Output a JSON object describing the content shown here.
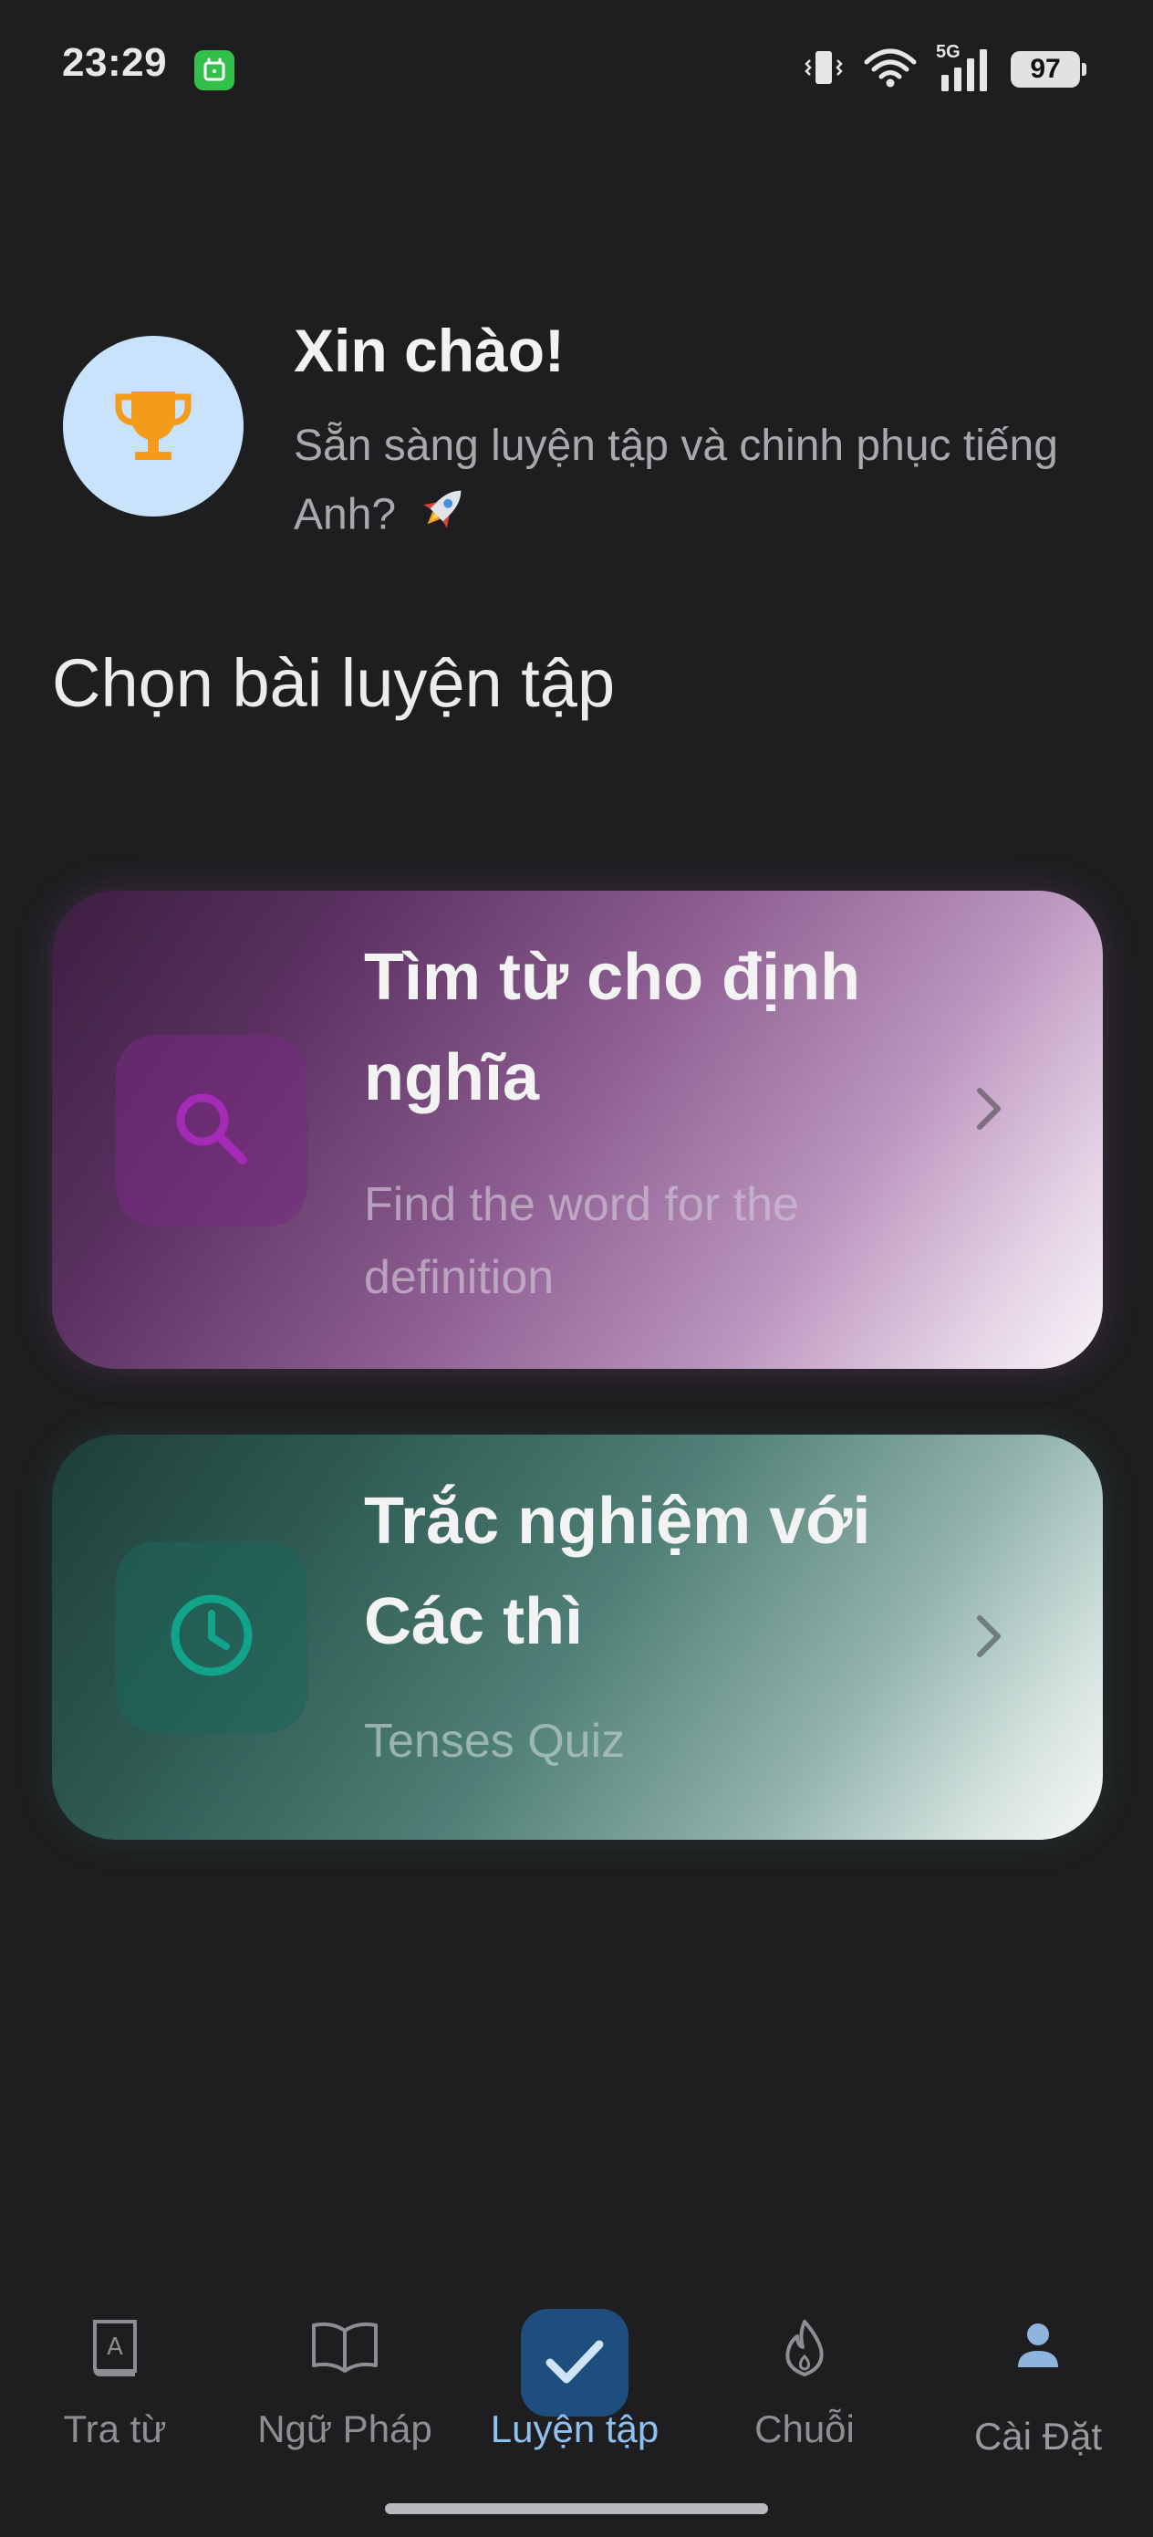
{
  "status_bar": {
    "time": "23:29",
    "battery": "97",
    "network": "5G",
    "icons": [
      "app-notification-icon",
      "vibrate-icon",
      "wifi-icon",
      "signal-icon",
      "battery-icon"
    ]
  },
  "greeting": {
    "title": "Xin chào!",
    "subtitle": "Sẵn sàng luyện tập và chinh phục tiếng Anh?",
    "avatar_icon": "trophy-icon",
    "emoji_icon": "rocket-icon"
  },
  "section": {
    "title": "Chọn bài luyện tập"
  },
  "cards": [
    {
      "title": "Tìm từ cho định nghĩa",
      "subtitle": "Find the word for the definition",
      "icon": "search-icon",
      "accent": "#9c27b0"
    },
    {
      "title": "Trắc nghiệm với Các thì",
      "subtitle": "Tenses Quiz",
      "icon": "clock-icon",
      "accent": "#10a58c"
    }
  ],
  "bottom_nav": {
    "active_index": 2,
    "items": [
      {
        "label": "Tra từ",
        "icon": "dictionary-icon"
      },
      {
        "label": "Ngữ Pháp",
        "icon": "book-icon"
      },
      {
        "label": "Luyện tập",
        "icon": "check-icon"
      },
      {
        "label": "Chuỗi",
        "icon": "flame-icon"
      },
      {
        "label": "Cài Đặt",
        "icon": "person-icon"
      }
    ]
  },
  "colors": {
    "background": "#1e1e20",
    "active_nav": "#8fc0f2",
    "active_pill": "#1e4e7e",
    "trophy": "#f59b1b",
    "avatar_bg": "#c8e3fb"
  }
}
